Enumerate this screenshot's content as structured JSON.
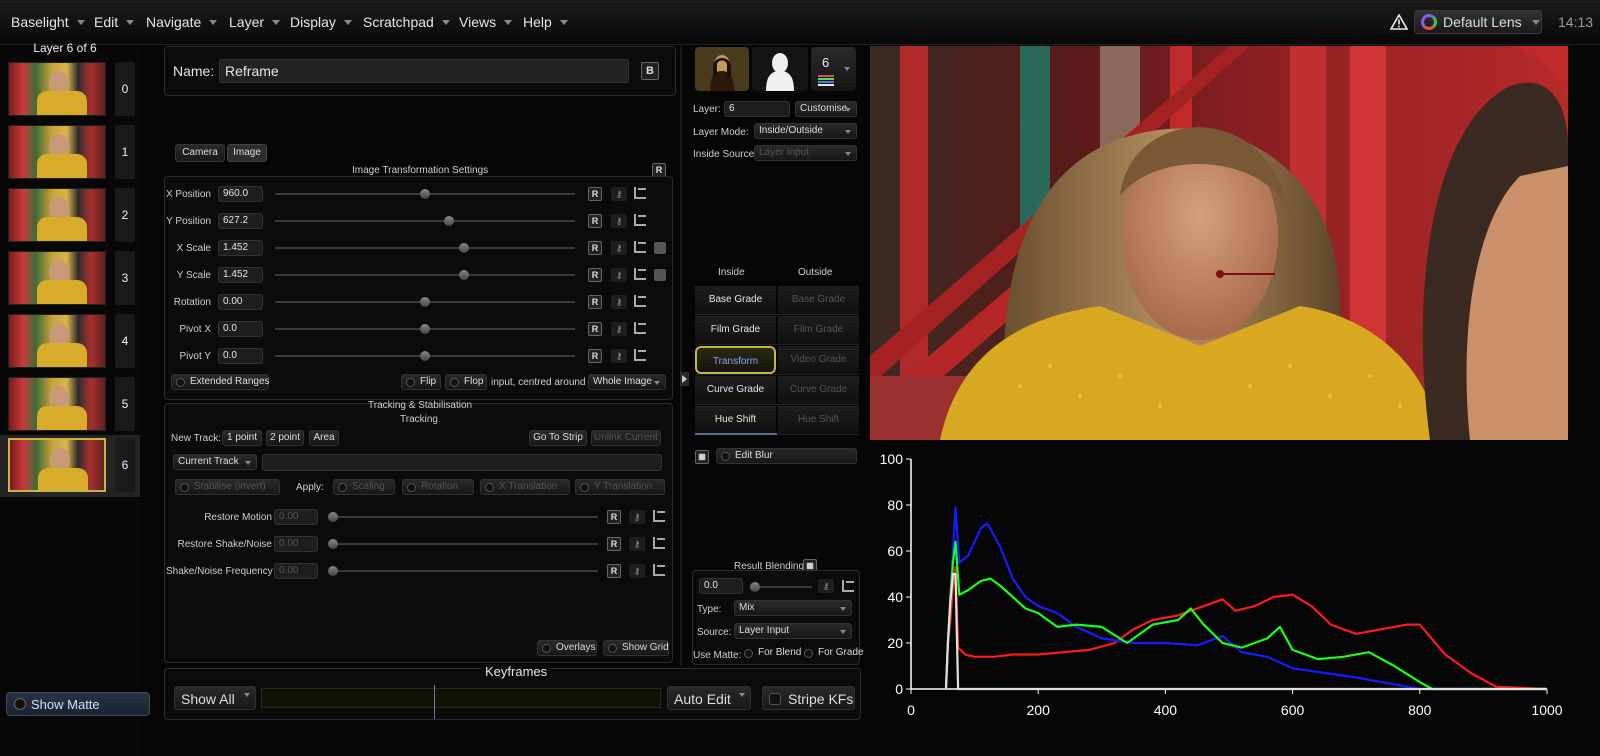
{
  "menubar": {
    "items": [
      "Baselight",
      "Edit",
      "Navigate",
      "Layer",
      "Display",
      "Scratchpad",
      "Views",
      "Help"
    ],
    "lens": "Default Lens",
    "clock": "14:13",
    "warning_icon": "warning-triangle-icon",
    "lens_icon": "color-wheel-icon"
  },
  "sidebar": {
    "title": "Layer 6 of 6",
    "layers": [
      "0",
      "1",
      "2",
      "3",
      "4",
      "5",
      "6"
    ],
    "selected": "6",
    "show_matte": "Show Matte"
  },
  "name_panel": {
    "label": "Name:",
    "value": "Reframe",
    "button": "B"
  },
  "tabs": [
    "Camera",
    "Image"
  ],
  "active_tab": "Image",
  "transform": {
    "title": "Image Transformation Settings",
    "reset": "R",
    "rows": [
      {
        "label": "X Position",
        "value": "960.0",
        "knob": 0.5
      },
      {
        "label": "Y Position",
        "value": "627.2",
        "knob": 0.58
      },
      {
        "label": "X Scale",
        "value": "1.452",
        "knob": 0.63,
        "chain": true
      },
      {
        "label": "Y Scale",
        "value": "1.452",
        "knob": 0.63,
        "chain": true
      },
      {
        "label": "Rotation",
        "value": "0.00",
        "knob": 0.5
      },
      {
        "label": "Pivot X",
        "value": "0.0",
        "knob": 0.5
      },
      {
        "label": "Pivot Y",
        "value": "0.0",
        "knob": 0.5
      }
    ],
    "extended_ranges": "Extended Ranges",
    "flip": "Flip",
    "flop": "Flop",
    "input_text": "input, centred around",
    "centre_mode": "Whole Image"
  },
  "tracking": {
    "title": "Tracking & Stabilisation",
    "subtitle": "Tracking",
    "new_track_label": "New Track:",
    "track_buttons": [
      "1 point",
      "2 point",
      "Area"
    ],
    "go_to_strip": "Go To Strip",
    "unlink_current": "Unlink Current",
    "current_track": "Current Track",
    "stabilise": "Stabilise (invert)",
    "apply_label": "Apply:",
    "apply_options": [
      "Scaling",
      "Rotation",
      "X Translation",
      "Y Translation"
    ],
    "restore_rows": [
      {
        "label": "Restore Motion",
        "value": "0.00"
      },
      {
        "label": "Restore Shake/Noise",
        "value": "0.00"
      },
      {
        "label": "Shake/Noise Frequency",
        "value": "0.00"
      }
    ],
    "overlays": "Overlays",
    "show_grid": "Show Grid"
  },
  "layer_panel": {
    "layer_count": "6",
    "layer_label": "Layer:",
    "layer_value": "6",
    "customise": "Customise",
    "mode_label": "Layer Mode:",
    "mode_value": "Inside/Outside",
    "source_label": "Inside Source:",
    "source_value": "Layer Input",
    "inside_label": "Inside",
    "outside_label": "Outside",
    "stack": [
      {
        "inside": "Base Grade",
        "outside": "Base Grade"
      },
      {
        "inside": "Film Grade",
        "outside": "Film Grade"
      },
      {
        "inside": "Transform",
        "outside": "Video Grade"
      },
      {
        "inside": "Curve Grade",
        "outside": "Curve Grade"
      },
      {
        "inside": "Hue Shift",
        "outside": "Hue Shift"
      }
    ],
    "edit_blur": "Edit Blur",
    "result_blending": "Result Blending",
    "blend_value": "0.0",
    "type_label": "Type:",
    "type_value": "Mix",
    "blend_source_label": "Source:",
    "blend_source_value": "Layer Input",
    "use_matte_label": "Use Matte:",
    "for_blend": "For Blend",
    "for_grade": "For Grade"
  },
  "keyframes": {
    "title": "Keyframes",
    "show": "Show All",
    "auto_edit": "Auto Edit",
    "stripe": "Stripe KFs",
    "playhead": 0.43
  },
  "chart_data": {
    "type": "line",
    "title": "",
    "xlabel": "",
    "ylabel": "",
    "xlim": [
      0,
      1000
    ],
    "ylim": [
      0,
      100
    ],
    "xticks": [
      0,
      200,
      400,
      600,
      800,
      1000
    ],
    "yticks": [
      0,
      20,
      40,
      60,
      80,
      100
    ],
    "grid": false,
    "series": [
      {
        "color": "#ff1a1a",
        "x": [
          55,
          58,
          62,
          65,
          70,
          74,
          85,
          100,
          130,
          160,
          200,
          240,
          280,
          320,
          350,
          380,
          420,
          460,
          490,
          510,
          540,
          570,
          600,
          630,
          660,
          700,
          740,
          780,
          800,
          840,
          880,
          920,
          1000
        ],
        "y": [
          0,
          20,
          30,
          42,
          53,
          18,
          15,
          14,
          14,
          15,
          15,
          16,
          17,
          20,
          26,
          30,
          32,
          36,
          39,
          34,
          36,
          40,
          41,
          36,
          28,
          24,
          26,
          28,
          28,
          15,
          7,
          1,
          0
        ]
      },
      {
        "color": "#1a1aff",
        "x": [
          55,
          58,
          62,
          66,
          70,
          76,
          90,
          110,
          120,
          140,
          160,
          180,
          200,
          230,
          260,
          300,
          350,
          400,
          450,
          490,
          520,
          560,
          600,
          650,
          700,
          740,
          780,
          800,
          1000
        ],
        "y": [
          0,
          20,
          40,
          60,
          79,
          55,
          58,
          70,
          72,
          62,
          48,
          40,
          36,
          33,
          27,
          22,
          20,
          20,
          19,
          23,
          16,
          14,
          9,
          7,
          5,
          3,
          1,
          0,
          0
        ]
      },
      {
        "color": "#1aff1a",
        "x": [
          55,
          58,
          62,
          66,
          70,
          76,
          90,
          110,
          125,
          140,
          160,
          180,
          200,
          230,
          260,
          300,
          340,
          380,
          420,
          440,
          460,
          490,
          520,
          560,
          580,
          600,
          640,
          680,
          720,
          760,
          800,
          820,
          1000
        ],
        "y": [
          0,
          20,
          40,
          55,
          64,
          41,
          43,
          47,
          48,
          45,
          40,
          35,
          33,
          27,
          28,
          27,
          20,
          28,
          30,
          35,
          28,
          20,
          18,
          22,
          27,
          17,
          13,
          14,
          16,
          10,
          3,
          0,
          0
        ]
      },
      {
        "color": "#e0e0e0",
        "x": [
          55,
          58,
          62,
          66,
          70,
          74,
          100,
          300,
          600,
          1000
        ],
        "y": [
          0,
          20,
          38,
          50,
          50,
          0,
          0,
          0,
          0,
          0
        ]
      }
    ]
  }
}
